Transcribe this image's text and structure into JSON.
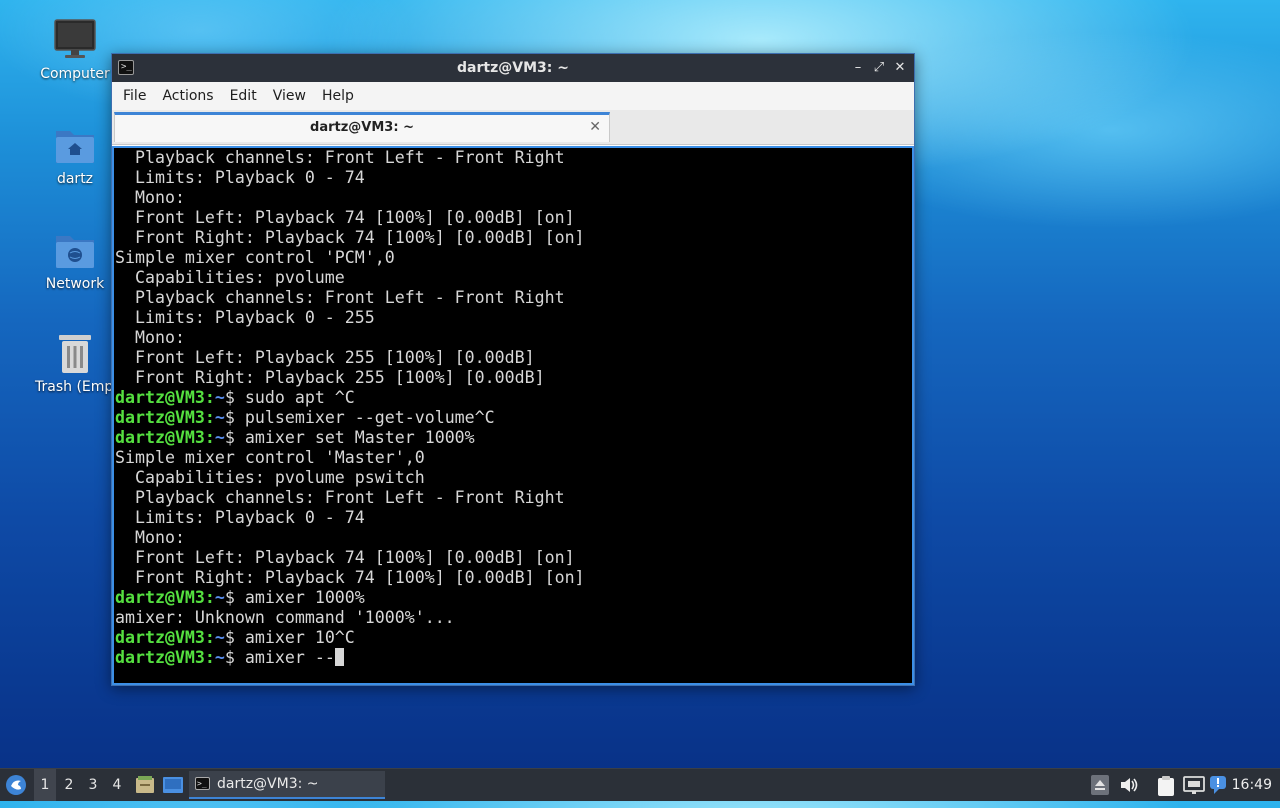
{
  "desktop": {
    "icons": [
      {
        "label": "Computer",
        "icon": "monitor-icon"
      },
      {
        "label": "dartz",
        "icon": "home-folder-icon"
      },
      {
        "label": "Network",
        "icon": "network-folder-icon"
      },
      {
        "label": "Trash (Empt",
        "icon": "trash-icon"
      }
    ]
  },
  "window": {
    "title": "dartz@VM3: ~",
    "minimize": "–",
    "maximize": "⤢",
    "close": "✕",
    "menu": [
      "File",
      "Actions",
      "Edit",
      "View",
      "Help"
    ],
    "tab_label": "dartz@VM3: ~",
    "tab_close": "✕"
  },
  "terminal": {
    "prompt_user": "dartz@VM3:",
    "prompt_path": "~",
    "prompt_symbol": "$ ",
    "lines": [
      {
        "type": "out",
        "text": "  Playback channels: Front Left - Front Right"
      },
      {
        "type": "out",
        "text": "  Limits: Playback 0 - 74"
      },
      {
        "type": "out",
        "text": "  Mono:"
      },
      {
        "type": "out",
        "text": "  Front Left: Playback 74 [100%] [0.00dB] [on]"
      },
      {
        "type": "out",
        "text": "  Front Right: Playback 74 [100%] [0.00dB] [on]"
      },
      {
        "type": "out",
        "text": "Simple mixer control 'PCM',0"
      },
      {
        "type": "out",
        "text": "  Capabilities: pvolume"
      },
      {
        "type": "out",
        "text": "  Playback channels: Front Left - Front Right"
      },
      {
        "type": "out",
        "text": "  Limits: Playback 0 - 255"
      },
      {
        "type": "out",
        "text": "  Mono:"
      },
      {
        "type": "out",
        "text": "  Front Left: Playback 255 [100%] [0.00dB]"
      },
      {
        "type": "out",
        "text": "  Front Right: Playback 255 [100%] [0.00dB]"
      },
      {
        "type": "cmd",
        "text": "sudo apt ^C"
      },
      {
        "type": "cmd",
        "text": "pulsemixer --get-volume^C"
      },
      {
        "type": "cmd",
        "text": "amixer set Master 1000%"
      },
      {
        "type": "out",
        "text": "Simple mixer control 'Master',0"
      },
      {
        "type": "out",
        "text": "  Capabilities: pvolume pswitch"
      },
      {
        "type": "out",
        "text": "  Playback channels: Front Left - Front Right"
      },
      {
        "type": "out",
        "text": "  Limits: Playback 0 - 74"
      },
      {
        "type": "out",
        "text": "  Mono:"
      },
      {
        "type": "out",
        "text": "  Front Left: Playback 74 [100%] [0.00dB] [on]"
      },
      {
        "type": "out",
        "text": "  Front Right: Playback 74 [100%] [0.00dB] [on]"
      },
      {
        "type": "cmd",
        "text": "amixer 1000%"
      },
      {
        "type": "out",
        "text": "amixer: Unknown command '1000%'..."
      },
      {
        "type": "cmd",
        "text": "amixer 10^C"
      },
      {
        "type": "cmd",
        "text": "amixer --",
        "cursor": true
      }
    ]
  },
  "taskbar": {
    "workspaces": [
      "1",
      "2",
      "3",
      "4"
    ],
    "active_workspace": "1",
    "task_label": "dartz@VM3: ~",
    "clock": "16:49",
    "colors": {
      "accent": "#3d84d6",
      "prompt_user": "#55e040",
      "prompt_path": "#5a8ff0"
    }
  }
}
